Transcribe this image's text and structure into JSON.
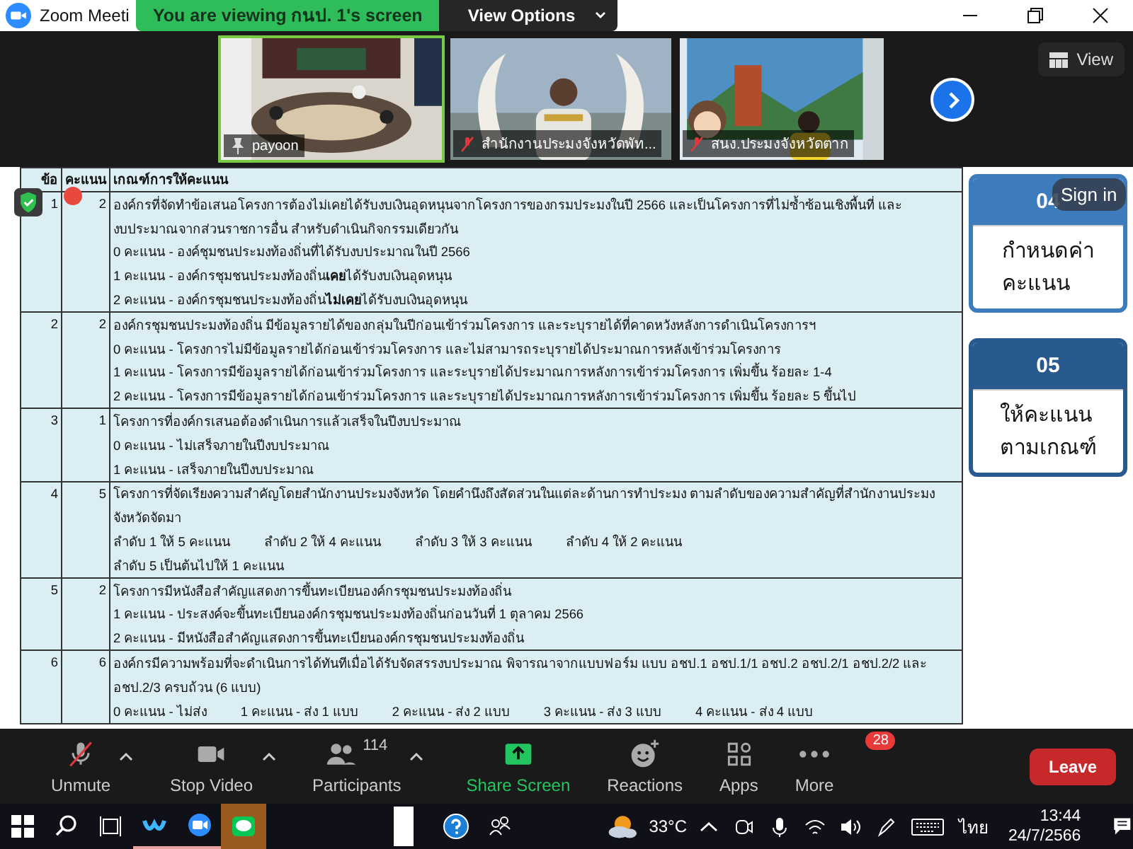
{
  "window": {
    "title": "Zoom Meeti"
  },
  "share_banner": {
    "text": "You are viewing กนป. 1's screen",
    "button": "View Options"
  },
  "videos": [
    {
      "name": "payoon",
      "kind": "pinned",
      "speaking": true
    },
    {
      "name": "สำนักงานประมงจังหวัดพัท...",
      "kind": "muted",
      "speaking": false
    },
    {
      "name": "สนง.ประมงจังหวัดตาก",
      "kind": "muted",
      "speaking": false
    }
  ],
  "view_button": "View",
  "table": {
    "columns": [
      "ข้อ",
      "คะแนน",
      "เกณฑ์การให้คะแนน"
    ],
    "rows": [
      {
        "number": "1",
        "score": "2",
        "lines": [
          [
            "องค์กรที่จัดทำข้อเสนอโครงการต้องไม่เคยได้รับงบเงินอุดหนุนจากโครงการของกรมประมงในปี 2566 และเป็นโครงการที่ไม่ซ้ำซ้อนเชิงพื้นที่ และ"
          ],
          [
            "งบประมาณจากส่วนราชการอื่น สำหรับดำเนินกิจกรรมเดียวกัน"
          ],
          [
            "0 คะแนน - องค์ชุมชนประมงท้องถิ่นที่ได้รับงบประมาณในปี 2566"
          ],
          [
            "1 คะแนน - องค์กรชุมชนประมงท้องถิ่น**เคย**ได้รับงบเงินอุดหนุน"
          ],
          [
            "2 คะแนน - องค์กรชุมชนประมงท้องถิ่น**ไม่เคย**ได้รับงบเงินอุดหนุน"
          ]
        ]
      },
      {
        "number": "2",
        "score": "2",
        "lines": [
          [
            "องค์กรชุมชนประมงท้องถิ่น มีข้อมูลรายได้ของกลุ่มในปีก่อนเข้าร่วมโครงการ และระบุรายได้ที่คาดหวังหลังการดำเนินโครงการฯ"
          ],
          [
            "0 คะแนน - โครงการไม่มีข้อมูลรายได้ก่อนเข้าร่วมโครงการ และไม่สามารถระบุรายได้ประมาณการหลังเข้าร่วมโครงการ"
          ],
          [
            "1 คะแนน - โครงการมีข้อมูลรายได้ก่อนเข้าร่วมโครงการ และระบุรายได้ประมาณการหลังการเข้าร่วมโครงการ เพิ่มขึ้น ร้อยละ 1-4"
          ],
          [
            "2 คะแนน - โครงการมีข้อมูลรายได้ก่อนเข้าร่วมโครงการ และระบุรายได้ประมาณการหลังการเข้าร่วมโครงการ เพิ่มขึ้น ร้อยละ 5 ขึ้นไป"
          ]
        ]
      },
      {
        "number": "3",
        "score": "1",
        "lines": [
          [
            "โครงการที่องค์กรเสนอต้องดำเนินการแล้วเสร็จในปีงบประมาณ"
          ],
          [
            "0 คะแนน - ไม่เสร็จภายในปีงบประมาณ"
          ],
          [
            "1 คะแนน - เสร็จภายในปีงบประมาณ"
          ]
        ]
      },
      {
        "number": "4",
        "score": "5",
        "lines": [
          [
            "โครงการที่จัดเรียงความสำคัญโดยสำนักงานประมงจังหวัด โดยคำนึงถึงสัดส่วนในแต่ละด้านการทำประมง ตามลำดับของความสำคัญที่สำนักงานประมง"
          ],
          [
            "จังหวัดจัดมา"
          ],
          [
            "ลำดับ 1 ให้ 5 คะแนน",
            "ลำดับ 2 ให้ 4 คะแนน",
            "ลำดับ 3 ให้ 3 คะแนน",
            "ลำดับ 4 ให้ 2 คะแนน"
          ],
          [
            "ลำดับ 5 เป็นต้นไปให้ 1 คะแนน"
          ]
        ]
      },
      {
        "number": "5",
        "score": "2",
        "lines": [
          [
            "โครงการมีหนังสือสำคัญแสดงการขึ้นทะเบียนองค์กรชุมชนประมงท้องถิ่น"
          ],
          [
            "1 คะแนน - ประสงค์จะขึ้นทะเบียนองค์กรชุมชนประมงท้องถิ่นก่อนวันที่ 1 ตุลาคม 2566"
          ],
          [
            "2 คะแนน - มีหนังสือสำคัญแสดงการขึ้นทะเบียนองค์กรชุมชนประมงท้องถิ่น"
          ]
        ]
      },
      {
        "number": "6",
        "score": "6",
        "lines": [
          [
            "องค์กรมีความพร้อมที่จะดำเนินการได้ทันทีเมื่อได้รับจัดสรรงบประมาณ พิจารณาจากแบบฟอร์ม แบบ อชป.1 อชป.1/1 อชป.2 อชป.2/1 อชป.2/2 และ"
          ],
          [
            "อชป.2/3 ครบถ้วน (6 แบบ)"
          ],
          [
            "0 คะแนน - ไม่ส่ง",
            "1 คะแนน - ส่ง 1 แบบ",
            "2 คะแนน - ส่ง 2 แบบ",
            "3 คะแนน - ส่ง 3 แบบ",
            "4 คะแนน - ส่ง 4 แบบ"
          ]
        ]
      }
    ]
  },
  "side_cards": [
    {
      "number": "04",
      "lines": [
        "กำหนดค่า",
        "คะแนน"
      ],
      "color": "#3c7cbc"
    },
    {
      "number": "05",
      "lines": [
        "ให้คะแนน",
        "ตามเกณฑ์"
      ],
      "color": "#28598f"
    }
  ],
  "sign_in": "Sign in",
  "toolbar": [
    {
      "kind": "mic",
      "label": "Unmute",
      "caret": true
    },
    {
      "kind": "video",
      "label": "Stop Video",
      "caret": true
    },
    {
      "kind": "participants",
      "label": "Participants",
      "count": "114",
      "caret": true
    },
    {
      "kind": "share",
      "label": "Share Screen",
      "caret": false
    },
    {
      "kind": "reactions",
      "label": "Reactions",
      "caret": false
    },
    {
      "kind": "apps",
      "label": "Apps",
      "caret": false
    },
    {
      "kind": "more",
      "label": "More",
      "badge": "28",
      "caret": false
    }
  ],
  "leave_button": "Leave",
  "taskbar": {
    "weather": "33°C",
    "language": "ไทย",
    "time": "13:44",
    "date": "24/7/2566"
  }
}
